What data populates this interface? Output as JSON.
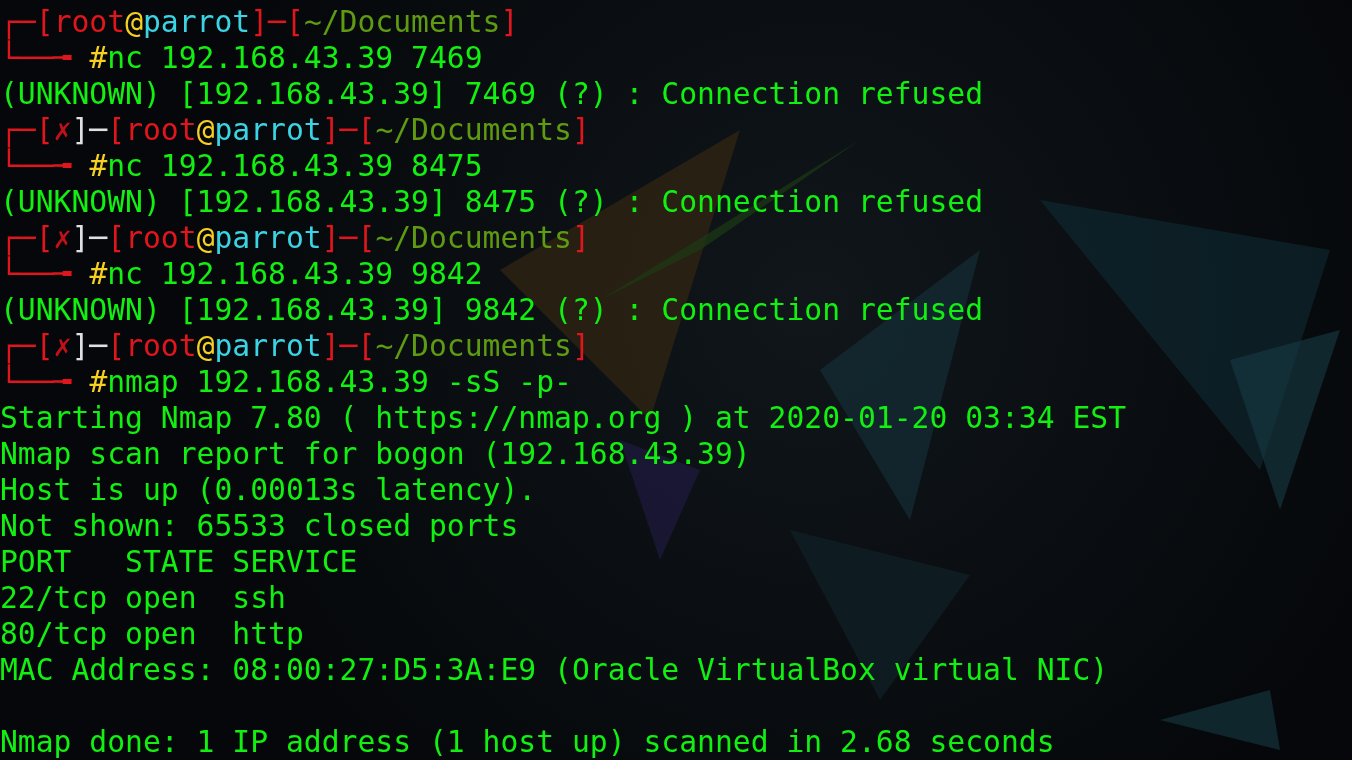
{
  "terminal": {
    "lines": [
      {
        "kind": "prompt_top",
        "segments": [
          {
            "kind": "frame",
            "text": "┌─["
          },
          {
            "kind": "user",
            "text": "root"
          },
          {
            "kind": "at",
            "text": "@"
          },
          {
            "kind": "host",
            "text": "parrot"
          },
          {
            "kind": "frame",
            "text": "]─["
          },
          {
            "kind": "path",
            "text": "~/Documents"
          },
          {
            "kind": "frame",
            "text": "]"
          }
        ]
      },
      {
        "kind": "prompt_bottom",
        "segments": [
          {
            "kind": "frame",
            "text": "└──╼ "
          },
          {
            "kind": "sigil",
            "text": "#"
          },
          {
            "kind": "command",
            "text": "nc 192.168.43.39 7469"
          }
        ]
      },
      {
        "kind": "output",
        "text": "(UNKNOWN) [192.168.43.39] 7469 (?) : Connection refused"
      },
      {
        "kind": "prompt_top",
        "segments": [
          {
            "kind": "frame",
            "text": "┌─["
          },
          {
            "kind": "mark",
            "text": "✗"
          },
          {
            "kind": "plain",
            "text": "]─"
          },
          {
            "kind": "frame",
            "text": "["
          },
          {
            "kind": "user",
            "text": "root"
          },
          {
            "kind": "at",
            "text": "@"
          },
          {
            "kind": "host",
            "text": "parrot"
          },
          {
            "kind": "frame",
            "text": "]─["
          },
          {
            "kind": "path",
            "text": "~/Documents"
          },
          {
            "kind": "frame",
            "text": "]"
          }
        ]
      },
      {
        "kind": "prompt_bottom",
        "segments": [
          {
            "kind": "frame",
            "text": "└──╼ "
          },
          {
            "kind": "sigil",
            "text": "#"
          },
          {
            "kind": "command",
            "text": "nc 192.168.43.39 8475"
          }
        ]
      },
      {
        "kind": "output",
        "text": "(UNKNOWN) [192.168.43.39] 8475 (?) : Connection refused"
      },
      {
        "kind": "prompt_top",
        "segments": [
          {
            "kind": "frame",
            "text": "┌─["
          },
          {
            "kind": "mark",
            "text": "✗"
          },
          {
            "kind": "plain",
            "text": "]─"
          },
          {
            "kind": "frame",
            "text": "["
          },
          {
            "kind": "user",
            "text": "root"
          },
          {
            "kind": "at",
            "text": "@"
          },
          {
            "kind": "host",
            "text": "parrot"
          },
          {
            "kind": "frame",
            "text": "]─["
          },
          {
            "kind": "path",
            "text": "~/Documents"
          },
          {
            "kind": "frame",
            "text": "]"
          }
        ]
      },
      {
        "kind": "prompt_bottom",
        "segments": [
          {
            "kind": "frame",
            "text": "└──╼ "
          },
          {
            "kind": "sigil",
            "text": "#"
          },
          {
            "kind": "command",
            "text": "nc 192.168.43.39 9842"
          }
        ]
      },
      {
        "kind": "output",
        "text": "(UNKNOWN) [192.168.43.39] 9842 (?) : Connection refused"
      },
      {
        "kind": "prompt_top",
        "segments": [
          {
            "kind": "frame",
            "text": "┌─["
          },
          {
            "kind": "mark",
            "text": "✗"
          },
          {
            "kind": "plain",
            "text": "]─"
          },
          {
            "kind": "frame",
            "text": "["
          },
          {
            "kind": "user",
            "text": "root"
          },
          {
            "kind": "at",
            "text": "@"
          },
          {
            "kind": "host",
            "text": "parrot"
          },
          {
            "kind": "frame",
            "text": "]─["
          },
          {
            "kind": "path",
            "text": "~/Documents"
          },
          {
            "kind": "frame",
            "text": "]"
          }
        ]
      },
      {
        "kind": "prompt_bottom",
        "segments": [
          {
            "kind": "frame",
            "text": "└──╼ "
          },
          {
            "kind": "sigil",
            "text": "#"
          },
          {
            "kind": "command",
            "text": "nmap 192.168.43.39 -sS -p-"
          }
        ]
      },
      {
        "kind": "output",
        "text": "Starting Nmap 7.80 ( https://nmap.org ) at 2020-01-20 03:34 EST"
      },
      {
        "kind": "output",
        "text": "Nmap scan report for bogon (192.168.43.39)"
      },
      {
        "kind": "output",
        "text": "Host is up (0.00013s latency)."
      },
      {
        "kind": "output",
        "text": "Not shown: 65533 closed ports"
      },
      {
        "kind": "output",
        "text": "PORT   STATE SERVICE"
      },
      {
        "kind": "output",
        "text": "22/tcp open  ssh"
      },
      {
        "kind": "output",
        "text": "80/tcp open  http"
      },
      {
        "kind": "output",
        "text": "MAC Address: 08:00:27:D5:3A:E9 (Oracle VirtualBox virtual NIC)"
      },
      {
        "kind": "blank"
      },
      {
        "kind": "output",
        "text": "Nmap done: 1 IP address (1 host up) scanned in 2.68 seconds"
      }
    ]
  }
}
